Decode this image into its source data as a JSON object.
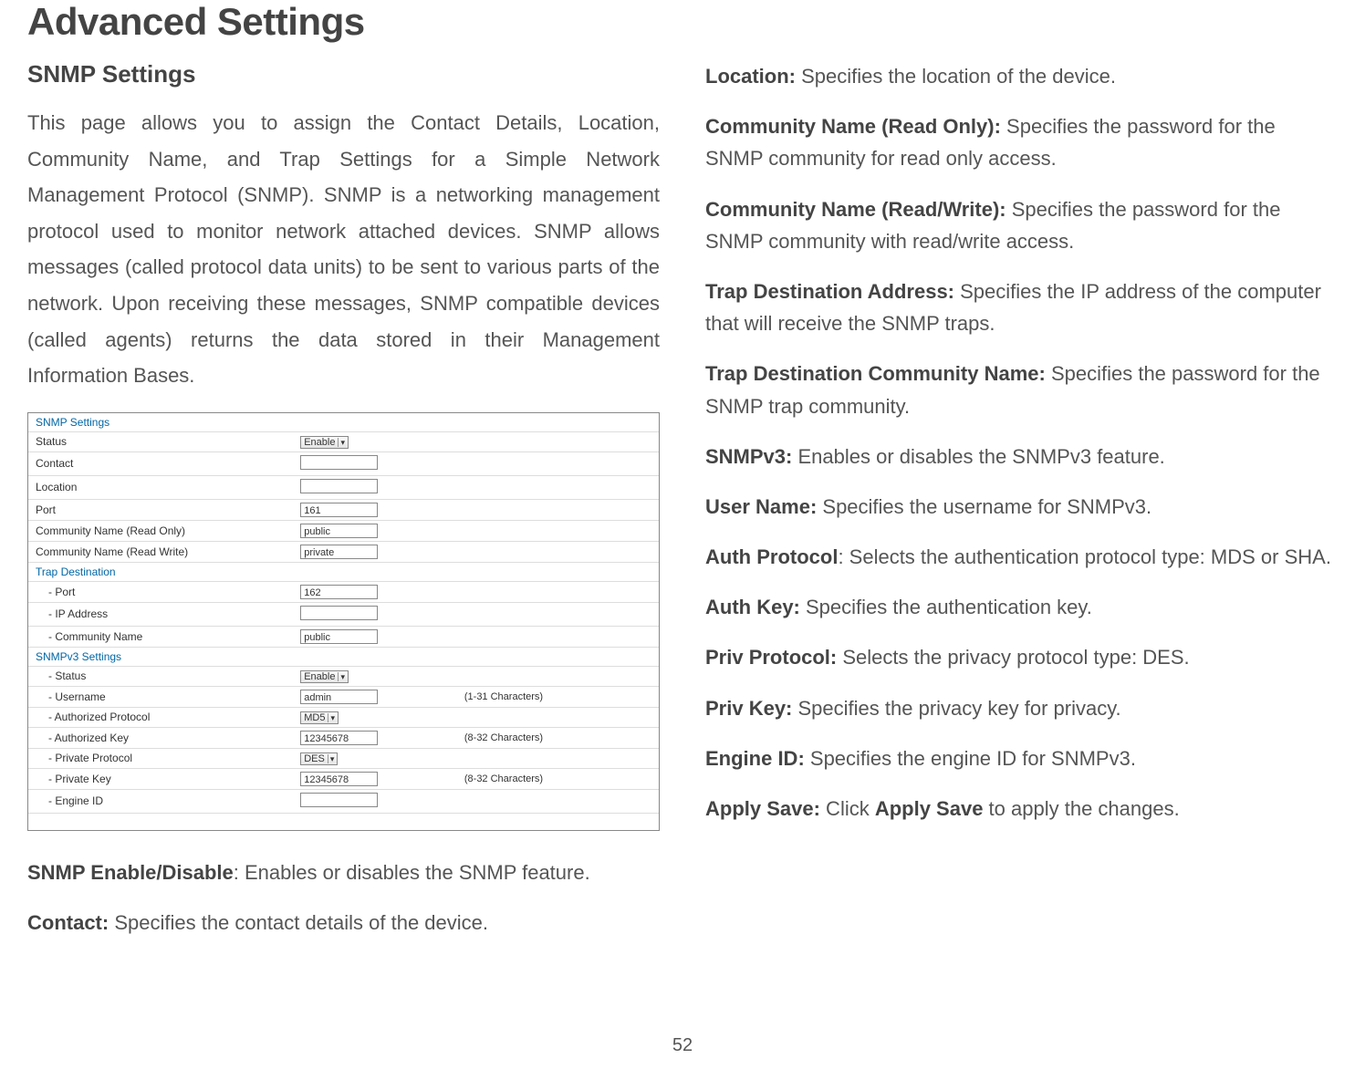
{
  "page_title": "Advanced Settings",
  "page_number": "52",
  "left": {
    "section_title": "SNMP Settings",
    "intro": "This page allows you to assign the Contact Details, Location, Community Name, and Trap Settings for a Simple Network Management Protocol (SNMP). SNMP is a networking management protocol used to monitor network attached devices. SNMP allows messages (called protocol data units) to be sent to various parts of the network. Upon receiving these messages, SNMP compatible devices (called agents) returns the data stored in their Management Information Bases.",
    "snmp_table": {
      "header": "SNMP Settings",
      "status_label": "Status",
      "status_value": "Enable",
      "contact_label": "Contact",
      "contact_value": "",
      "location_label": "Location",
      "location_value": "",
      "port_label": "Port",
      "port_value": "161",
      "comm_ro_label": "Community Name (Read Only)",
      "comm_ro_value": "public",
      "comm_rw_label": "Community Name (Read Write)",
      "comm_rw_value": "private",
      "trap_header": "Trap Destination",
      "trap_port_label": "- Port",
      "trap_port_value": "162",
      "trap_ip_label": "- IP Address",
      "trap_ip_value": "",
      "trap_comm_label": "- Community Name",
      "trap_comm_value": "public",
      "v3_header": "SNMPv3 Settings",
      "v3_status_label": "- Status",
      "v3_status_value": "Enable",
      "v3_user_label": "- Username",
      "v3_user_value": "admin",
      "v3_user_hint": "(1-31 Characters)",
      "v3_authproto_label": "- Authorized Protocol",
      "v3_authproto_value": "MD5",
      "v3_authkey_label": "- Authorized Key",
      "v3_authkey_value": "12345678",
      "v3_authkey_hint": "(8-32 Characters)",
      "v3_privproto_label": "- Private Protocol",
      "v3_privproto_value": "DES",
      "v3_privkey_label": "- Private Key",
      "v3_privkey_value": "12345678",
      "v3_privkey_hint": "(8-32 Characters)",
      "v3_engine_label": "- Engine ID",
      "v3_engine_value": ""
    },
    "desc1_label": "SNMP Enable/Disable",
    "desc1_text": ": Enables or disables the SNMP feature.",
    "desc2_label": "Contact:",
    "desc2_text": " Specifies the contact details of the device."
  },
  "right": {
    "d1_label": "Location:",
    "d1_text": " Specifies the location of the device.",
    "d2_label": "Community Name (Read Only):",
    "d2_text": " Specifies the password for the SNMP community for read only access.",
    "d3_label": "Community Name (Read/Write):",
    "d3_text": " Specifies the password for the SNMP community with read/write access.",
    "d4_label": "Trap Destination Address:",
    "d4_text": " Specifies the IP address of the computer that will receive the SNMP traps.",
    "d5_label": "Trap Destination Community Name:",
    "d5_text": " Specifies the password for the SNMP trap community.",
    "d6_label": "SNMPv3:",
    "d6_text": " Enables or disables the SNMPv3 feature.",
    "d7_label": "User Name:",
    "d7_text": " Specifies the username for SNMPv3.",
    "d8_label": "Auth Protocol",
    "d8_text": ": Selects the authentication protocol type: MDS or SHA.",
    "d9_label": "Auth Key:",
    "d9_text": " Specifies the authentication key.",
    "d10_label": "Priv Protocol:",
    "d10_text": " Selects the privacy protocol type: DES.",
    "d11_label": "Priv Key:",
    "d11_text": " Specifies the privacy key for privacy.",
    "d12_label": "Engine ID:",
    "d12_text": " Specifies the engine ID for SNMPv3.",
    "d13_label": "Apply Save:",
    "d13_text_a": " Click ",
    "d13_bold": "Apply Save",
    "d13_text_b": " to apply the changes."
  }
}
